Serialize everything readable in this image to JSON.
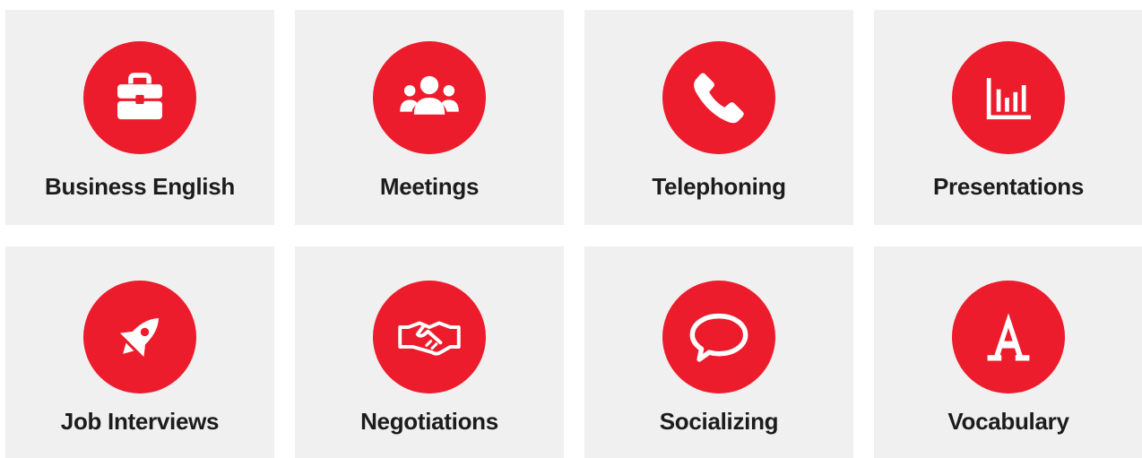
{
  "accent_color": "#ec1c2c",
  "card_background": "#f0f0f0",
  "cards": [
    {
      "label": "Business English",
      "icon": "briefcase-icon"
    },
    {
      "label": "Meetings",
      "icon": "people-group-icon"
    },
    {
      "label": "Telephoning",
      "icon": "phone-icon"
    },
    {
      "label": "Presentations",
      "icon": "bar-chart-icon"
    },
    {
      "label": "Job Interviews",
      "icon": "rocket-icon"
    },
    {
      "label": "Negotiations",
      "icon": "handshake-icon"
    },
    {
      "label": "Socializing",
      "icon": "speech-bubble-icon"
    },
    {
      "label": "Vocabulary",
      "icon": "letter-a-icon"
    }
  ]
}
